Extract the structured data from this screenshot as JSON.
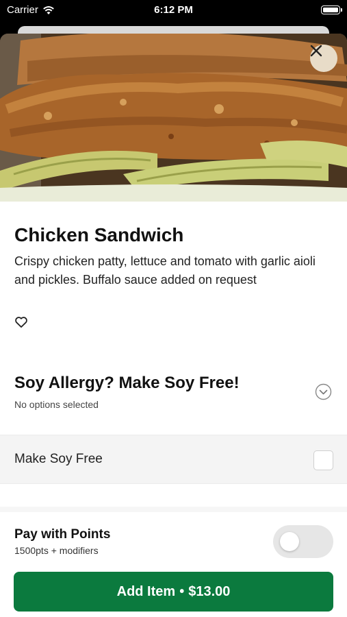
{
  "status_bar": {
    "carrier": "Carrier",
    "time": "6:12 PM"
  },
  "item": {
    "title": "Chicken Sandwich",
    "description": "Crispy chicken patty, lettuce and tomato with garlic aioli and pickles. Buffalo sauce added on request"
  },
  "modifier_group": {
    "title": "Soy Allergy? Make Soy Free!",
    "status": "No options selected",
    "options": [
      {
        "label": "Make Soy Free",
        "checked": false
      }
    ]
  },
  "points": {
    "label": "Pay with Points",
    "sub": "1500pts + modifiers",
    "enabled": false
  },
  "add_button": {
    "label": "Add Item",
    "separator": "•",
    "price": "$13.00"
  },
  "colors": {
    "accent": "#0b7a3e",
    "toggle_off": "#e6e6e6",
    "close_bg": "#e8dcc8"
  },
  "icons": {
    "close": "close-icon",
    "favorite": "heart-icon",
    "expand": "chevron-down-icon",
    "wifi": "wifi-icon",
    "battery": "battery-icon"
  }
}
